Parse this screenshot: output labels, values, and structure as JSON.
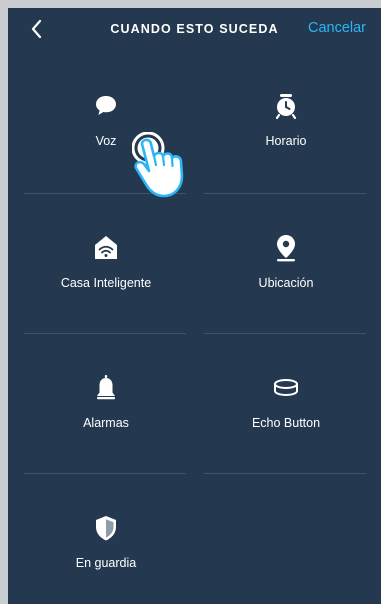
{
  "header": {
    "title": "CUANDO ESTO SUCEDA",
    "cancel_label": "Cancelar"
  },
  "triggers": [
    {
      "label": "Voz",
      "icon": "speech-bubble-icon"
    },
    {
      "label": "Horario",
      "icon": "alarm-clock-icon"
    },
    {
      "label": "Casa Inteligente",
      "icon": "smart-home-icon"
    },
    {
      "label": "Ubicación",
      "icon": "location-pin-icon"
    },
    {
      "label": "Alarmas",
      "icon": "bell-icon"
    },
    {
      "label": "Echo Button",
      "icon": "echo-button-icon"
    },
    {
      "label": "En guardia",
      "icon": "shield-icon"
    }
  ],
  "colors": {
    "background": "#24394f",
    "accent": "#29b6f6",
    "text": "#ffffff",
    "divider": "#3c5269"
  }
}
